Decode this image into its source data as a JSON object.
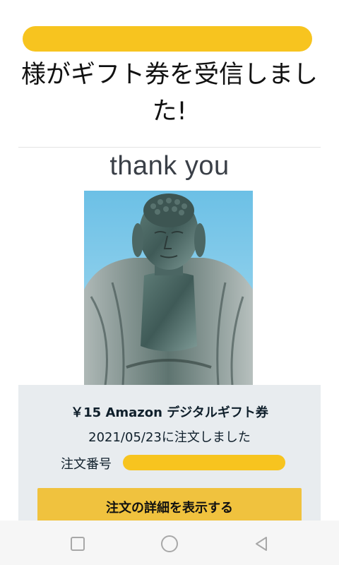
{
  "header": {
    "headline": "様がギフト券を受信しました!"
  },
  "greeting": {
    "text": "thank you"
  },
  "card": {
    "gift_title": "￥15 Amazon デジタルギフト券",
    "order_date": "2021/05/23に注文しました",
    "order_number_label": "注文番号",
    "detail_button": "注文の詳細を表示する"
  },
  "navbar": {
    "items": [
      "recent-apps-icon",
      "home-icon",
      "back-icon"
    ]
  },
  "colors": {
    "redaction": "#f7c41f",
    "button": "#f0c23e",
    "card_bg": "#e8ecef",
    "sky": "#7fc8e8"
  }
}
